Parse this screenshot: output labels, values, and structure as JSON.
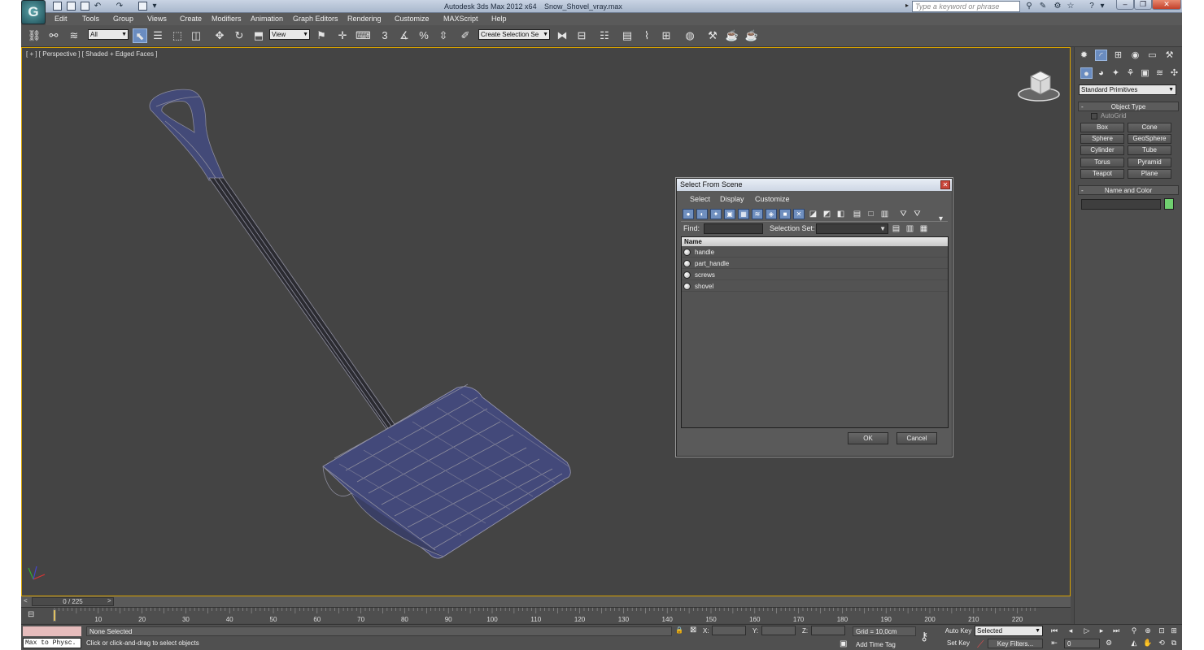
{
  "app": {
    "title": "Autodesk 3ds Max  2012 x64",
    "file": "Snow_Shovel_vray.max",
    "logo": "G"
  },
  "search": {
    "placeholder": "Type a keyword or phrase"
  },
  "menubar": [
    "Edit",
    "Tools",
    "Group",
    "Views",
    "Create",
    "Modifiers",
    "Animation",
    "Graph Editors",
    "Rendering",
    "Customize",
    "MAXScript",
    "Help"
  ],
  "toolbar": {
    "filter_value": "All",
    "refcoord_value": "View",
    "snap_labels": [
      "3",
      "%"
    ],
    "named_sel_placeholder": "Create Selection Se"
  },
  "viewport": {
    "label": "[ + ] [ Perspective ] [ Shaded + Edged Faces ]",
    "accent_color": "#d9a300"
  },
  "dialog": {
    "title": "Select From Scene",
    "menus": [
      "Select",
      "Display",
      "Customize"
    ],
    "find_label": "Find:",
    "selset_label": "Selection Set:",
    "column_header": "Name",
    "objects": [
      "handle",
      "part_handle",
      "screws",
      "shovel"
    ],
    "ok": "OK",
    "cancel": "Cancel"
  },
  "command_panel": {
    "dropdown": "Standard Primitives",
    "object_type_title": "Object Type",
    "autogrid": "AutoGrid",
    "primitives": [
      "Box",
      "Cone",
      "Sphere",
      "GeoSphere",
      "Cylinder",
      "Tube",
      "Torus",
      "Pyramid",
      "Teapot",
      "Plane"
    ],
    "name_color_title": "Name and Color",
    "swatch_color": "#70d070"
  },
  "timeline": {
    "slider": "0 / 225",
    "ticks": [
      "10",
      "20",
      "30",
      "40",
      "50",
      "60",
      "70",
      "80",
      "90",
      "100",
      "110",
      "120",
      "130",
      "140",
      "150",
      "160",
      "170",
      "180",
      "190",
      "200",
      "210",
      "220"
    ]
  },
  "status": {
    "maxscript_out": "Max to Physc.",
    "selection": "None Selected",
    "prompt": "Click or click-and-drag to select objects",
    "x": "X:",
    "y": "Y:",
    "z": "Z:",
    "grid": "Grid = 10,0cm",
    "add_time_tag": "Add Time Tag",
    "auto_key": "Auto Key",
    "auto_key_mode": "Selected",
    "set_key": "Set Key",
    "key_filters": "Key Filters...",
    "frame": "0"
  }
}
